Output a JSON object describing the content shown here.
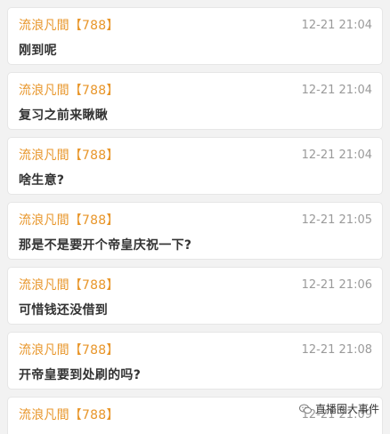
{
  "messages": [
    {
      "user": "流浪凡間【788】",
      "time": "12-21 21:04",
      "text": "刚到呢"
    },
    {
      "user": "流浪凡間【788】",
      "time": "12-21 21:04",
      "text": "复习之前来瞅瞅"
    },
    {
      "user": "流浪凡間【788】",
      "time": "12-21 21:04",
      "text": "啥生意?"
    },
    {
      "user": "流浪凡間【788】",
      "time": "12-21 21:05",
      "text": "那是不是要开个帝皇庆祝一下?"
    },
    {
      "user": "流浪凡間【788】",
      "time": "12-21 21:06",
      "text": "可惜钱还没借到"
    },
    {
      "user": "流浪凡間【788】",
      "time": "12-21 21:08",
      "text": "开帝皇要到处刷的吗?"
    },
    {
      "user": "流浪凡間【788】",
      "time": "12-21 21:09",
      "text": ""
    }
  ],
  "watermark": {
    "text": "直播圈大事件",
    "icon": "wechat-icon"
  }
}
